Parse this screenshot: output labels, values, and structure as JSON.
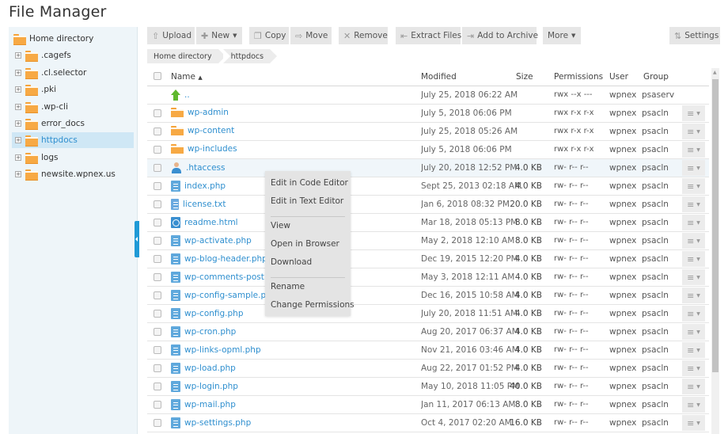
{
  "page": {
    "title": "File Manager"
  },
  "sidebar": {
    "items": [
      {
        "label": "Home directory",
        "root": true,
        "selected": false
      },
      {
        "label": ".cagefs",
        "root": false,
        "selected": false
      },
      {
        "label": ".cl.selector",
        "root": false,
        "selected": false
      },
      {
        "label": ".pki",
        "root": false,
        "selected": false
      },
      {
        "label": ".wp-cli",
        "root": false,
        "selected": false
      },
      {
        "label": "error_docs",
        "root": false,
        "selected": false
      },
      {
        "label": "httpdocs",
        "root": false,
        "selected": true
      },
      {
        "label": "logs",
        "root": false,
        "selected": false
      },
      {
        "label": "newsite.wpnex.us",
        "root": false,
        "selected": false
      }
    ],
    "expander_glyph": "+"
  },
  "toolbar": {
    "upload": {
      "label": "Upload",
      "icon": "upload-icon",
      "glyph": "⇧"
    },
    "new": {
      "label": "New",
      "icon": "plus-icon",
      "glyph": "✚"
    },
    "copy": {
      "label": "Copy",
      "icon": "copy-icon",
      "glyph": "❐"
    },
    "move": {
      "label": "Move",
      "icon": "arrow-right-icon",
      "glyph": "⇨"
    },
    "remove": {
      "label": "Remove",
      "icon": "remove-icon",
      "glyph": "✕"
    },
    "extract": {
      "label": "Extract Files",
      "icon": "extract-icon",
      "glyph": "⇤"
    },
    "archive": {
      "label": "Add to Archive",
      "icon": "archive-icon",
      "glyph": "⇥"
    },
    "more": {
      "label": "More"
    },
    "settings": {
      "label": "Settings",
      "icon": "settings-icon",
      "glyph": "⇅"
    },
    "caret": "▼"
  },
  "breadcrumb": [
    "Home directory",
    "httpdocs"
  ],
  "table": {
    "columns": {
      "name": "Name",
      "sort": "▲",
      "modified": "Modified",
      "size": "Size",
      "permissions": "Permissions",
      "user": "User",
      "group": "Group"
    },
    "rows": [
      {
        "name": "..",
        "icon": "up",
        "modified": "July 25, 2018 06:22 AM",
        "size": "",
        "perm": "rwx --x ---",
        "user": "wpnex",
        "group": "psaserv",
        "checkbox": false,
        "actions": false
      },
      {
        "name": "wp-admin",
        "icon": "folder",
        "modified": "July 5, 2018 06:06 PM",
        "size": "",
        "perm": "rwx r-x r-x",
        "user": "wpnex",
        "group": "psacln",
        "checkbox": true,
        "actions": true
      },
      {
        "name": "wp-content",
        "icon": "folder",
        "modified": "July 25, 2018 05:26 AM",
        "size": "",
        "perm": "rwx r-x r-x",
        "user": "wpnex",
        "group": "psacln",
        "checkbox": true,
        "actions": true
      },
      {
        "name": "wp-includes",
        "icon": "folder",
        "modified": "July 5, 2018 06:06 PM",
        "size": "",
        "perm": "rwx r-x r-x",
        "user": "wpnex",
        "group": "psacln",
        "checkbox": true,
        "actions": true
      },
      {
        "name": ".htaccess",
        "icon": "user",
        "modified": "July 20, 2018 12:52 PM",
        "size": "4.0 KB",
        "perm": "rw- r-- r--",
        "user": "wpnex",
        "group": "psacln",
        "checkbox": true,
        "actions": true,
        "highlight": true
      },
      {
        "name": "index.php",
        "icon": "doc",
        "modified": "Sept 25, 2013 02:18 AM",
        "size": "4.0 KB",
        "perm": "rw- r-- r--",
        "user": "wpnex",
        "group": "psacln",
        "checkbox": true,
        "actions": true
      },
      {
        "name": "license.txt",
        "icon": "txt",
        "modified": "Jan 6, 2018 08:32 PM",
        "size": "20.0 KB",
        "perm": "rw- r-- r--",
        "user": "wpnex",
        "group": "psacln",
        "checkbox": true,
        "actions": true
      },
      {
        "name": "readme.html",
        "icon": "html",
        "modified": "Mar 18, 2018 05:13 PM",
        "size": "8.0 KB",
        "perm": "rw- r-- r--",
        "user": "wpnex",
        "group": "psacln",
        "checkbox": true,
        "actions": true
      },
      {
        "name": "wp-activate.php",
        "icon": "doc",
        "modified": "May 2, 2018 12:10 AM",
        "size": "8.0 KB",
        "perm": "rw- r-- r--",
        "user": "wpnex",
        "group": "psacln",
        "checkbox": true,
        "actions": true
      },
      {
        "name": "wp-blog-header.php",
        "icon": "doc",
        "modified": "Dec 19, 2015 12:20 PM",
        "size": "4.0 KB",
        "perm": "rw- r-- r--",
        "user": "wpnex",
        "group": "psacln",
        "checkbox": true,
        "actions": true
      },
      {
        "name": "wp-comments-post.php",
        "icon": "doc",
        "modified": "May 3, 2018 12:11 AM",
        "size": "4.0 KB",
        "perm": "rw- r-- r--",
        "user": "wpnex",
        "group": "psacln",
        "checkbox": true,
        "actions": true
      },
      {
        "name": "wp-config-sample.php",
        "icon": "doc",
        "modified": "Dec 16, 2015 10:58 AM",
        "size": "4.0 KB",
        "perm": "rw- r-- r--",
        "user": "wpnex",
        "group": "psacln",
        "checkbox": true,
        "actions": true
      },
      {
        "name": "wp-config.php",
        "icon": "doc",
        "modified": "July 20, 2018 11:51 AM",
        "size": "4.0 KB",
        "perm": "rw- r-- r--",
        "user": "wpnex",
        "group": "psacln",
        "checkbox": true,
        "actions": true
      },
      {
        "name": "wp-cron.php",
        "icon": "doc",
        "modified": "Aug 20, 2017 06:37 AM",
        "size": "4.0 KB",
        "perm": "rw- r-- r--",
        "user": "wpnex",
        "group": "psacln",
        "checkbox": true,
        "actions": true
      },
      {
        "name": "wp-links-opml.php",
        "icon": "doc",
        "modified": "Nov 21, 2016 03:46 AM",
        "size": "4.0 KB",
        "perm": "rw- r-- r--",
        "user": "wpnex",
        "group": "psacln",
        "checkbox": true,
        "actions": true
      },
      {
        "name": "wp-load.php",
        "icon": "doc",
        "modified": "Aug 22, 2017 01:52 PM",
        "size": "4.0 KB",
        "perm": "rw- r-- r--",
        "user": "wpnex",
        "group": "psacln",
        "checkbox": true,
        "actions": true
      },
      {
        "name": "wp-login.php",
        "icon": "doc",
        "modified": "May 10, 2018 11:05 PM",
        "size": "40.0 KB",
        "perm": "rw- r-- r--",
        "user": "wpnex",
        "group": "psacln",
        "checkbox": true,
        "actions": true
      },
      {
        "name": "wp-mail.php",
        "icon": "doc",
        "modified": "Jan 11, 2017 06:13 AM",
        "size": "8.0 KB",
        "perm": "rw- r-- r--",
        "user": "wpnex",
        "group": "psacln",
        "checkbox": true,
        "actions": true
      },
      {
        "name": "wp-settings.php",
        "icon": "doc",
        "modified": "Oct 4, 2017 02:20 AM",
        "size": "16.0 KB",
        "perm": "rw- r-- r--",
        "user": "wpnex",
        "group": "psacln",
        "checkbox": true,
        "actions": true
      }
    ],
    "action_glyph": "≡",
    "action_caret": "▼"
  },
  "context_menu": {
    "groups": [
      [
        "Edit in Code Editor",
        "Edit in Text Editor"
      ],
      [
        "View",
        "Open in Browser",
        "Download"
      ],
      [
        "Rename",
        "Change Permissions"
      ]
    ]
  },
  "colors": {
    "link": "#2f8fcf",
    "accent": "#1f9ad6",
    "folder": "#f7a944",
    "selected_bg": "#cfe7f5"
  }
}
